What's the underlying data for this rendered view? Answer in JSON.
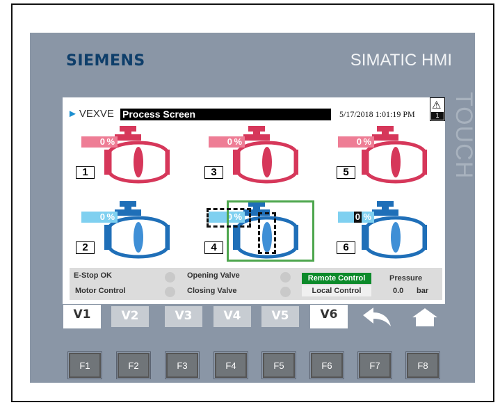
{
  "panel": {
    "brand": "SIEMENS",
    "model": "SIMATIC HMI",
    "touch": "TOUCH"
  },
  "screen": {
    "logo": "VEXVE",
    "title": "Process Screen",
    "datetime": "5/17/2018 1:01:19 PM",
    "alarm_count": "1"
  },
  "valves": [
    {
      "number": "1",
      "percent": "0",
      "unit": "%",
      "color": "red"
    },
    {
      "number": "3",
      "percent": "0",
      "unit": "%",
      "color": "red"
    },
    {
      "number": "5",
      "percent": "0",
      "unit": "%",
      "color": "red"
    },
    {
      "number": "2",
      "percent": "0",
      "unit": "%",
      "color": "blue"
    },
    {
      "number": "4",
      "percent": "0",
      "unit": "%",
      "color": "blue"
    },
    {
      "number": "6",
      "percent": "0",
      "unit": "%",
      "color": "blue"
    }
  ],
  "status": {
    "estop": "E-Stop OK",
    "motor": "Motor Control",
    "opening": "Opening Valve",
    "closing": "Closing Valve",
    "remote": "Remote Control",
    "local": "Local Control",
    "pressure_label": "Pressure",
    "pressure_value": "0.0",
    "pressure_unit": "bar"
  },
  "nav": {
    "buttons": [
      "V1",
      "V2",
      "V3",
      "V4",
      "V5",
      "V6"
    ],
    "back_icon": "back-arrow-icon",
    "home_icon": "home-icon"
  },
  "fkeys": [
    "F1",
    "F2",
    "F3",
    "F4",
    "F5",
    "F6",
    "F7",
    "F8"
  ],
  "colors": {
    "red_valve": "#d6375a",
    "blue_valve": "#1f6fb8",
    "remote_active": "#0c8a2a",
    "selection": "#4da64d"
  }
}
